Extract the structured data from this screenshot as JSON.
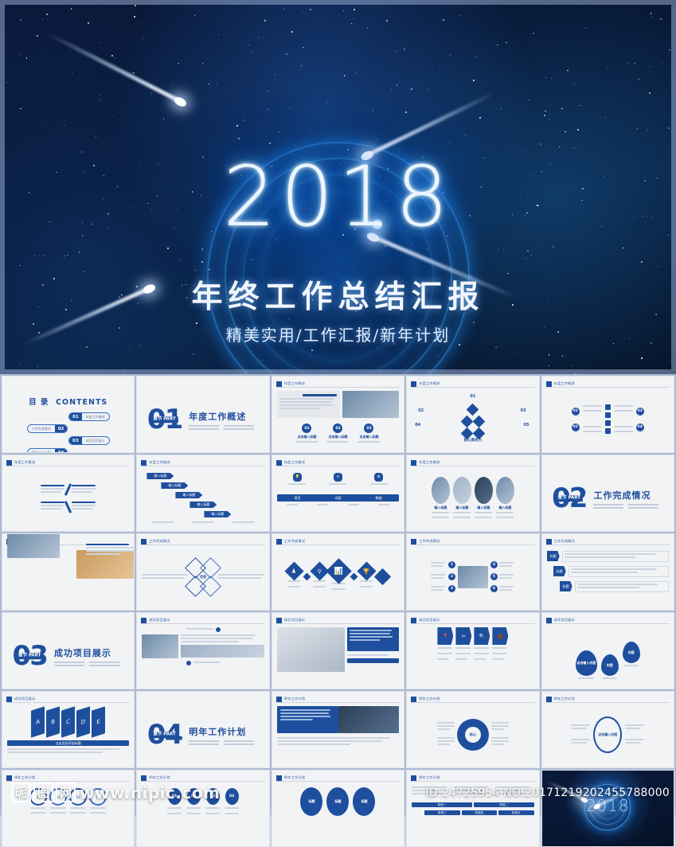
{
  "cover": {
    "year": "2018",
    "title": "年终工作总结汇报",
    "subtitle": "精美实用/工作汇报/新年计划"
  },
  "watermark": {
    "logo_chars": [
      "昵",
      "图",
      "网"
    ],
    "url": "www.nipic.com",
    "id_text": "ID:24725954 NO:20171219202455788000"
  },
  "contents_slide": {
    "title_cn": "目 录",
    "title_en": "CONTENTS",
    "items": [
      {
        "num": "01",
        "label": "年度工作概述"
      },
      {
        "num": "02",
        "label": "工作完成情况"
      },
      {
        "num": "03",
        "label": "成功项目展示"
      },
      {
        "num": "04",
        "label": "明年工作计划"
      }
    ]
  },
  "sections": [
    {
      "num": "01",
      "part": "章节 PART",
      "title": "年度工作概述"
    },
    {
      "num": "02",
      "part": "章节 PART",
      "title": "工作完成情况"
    },
    {
      "num": "03",
      "part": "章节 PART",
      "title": "成功项目展示"
    },
    {
      "num": "04",
      "part": "章节 PART",
      "title": "明年工作计划"
    }
  ],
  "headers": {
    "h1": "年度工作概述",
    "h2": "工作完成情况",
    "h3": "成功项目展示",
    "h4": "明年工作计划"
  },
  "labels": {
    "click_input": "点击输入标题",
    "add_title": "添加标题",
    "core_business": "核心商务力",
    "input_title": "输入标题",
    "enter_content": "点击输入内容"
  },
  "colors": {
    "accent": "#1e4f9e",
    "accent_light": "#3c6fc0",
    "slide_bg": "#f2f3f5",
    "grid_line": "#aebbd4",
    "page_bg": "#c9d3e6"
  },
  "grid": {
    "rows": 6,
    "cols": 5,
    "total_slides": 30
  }
}
